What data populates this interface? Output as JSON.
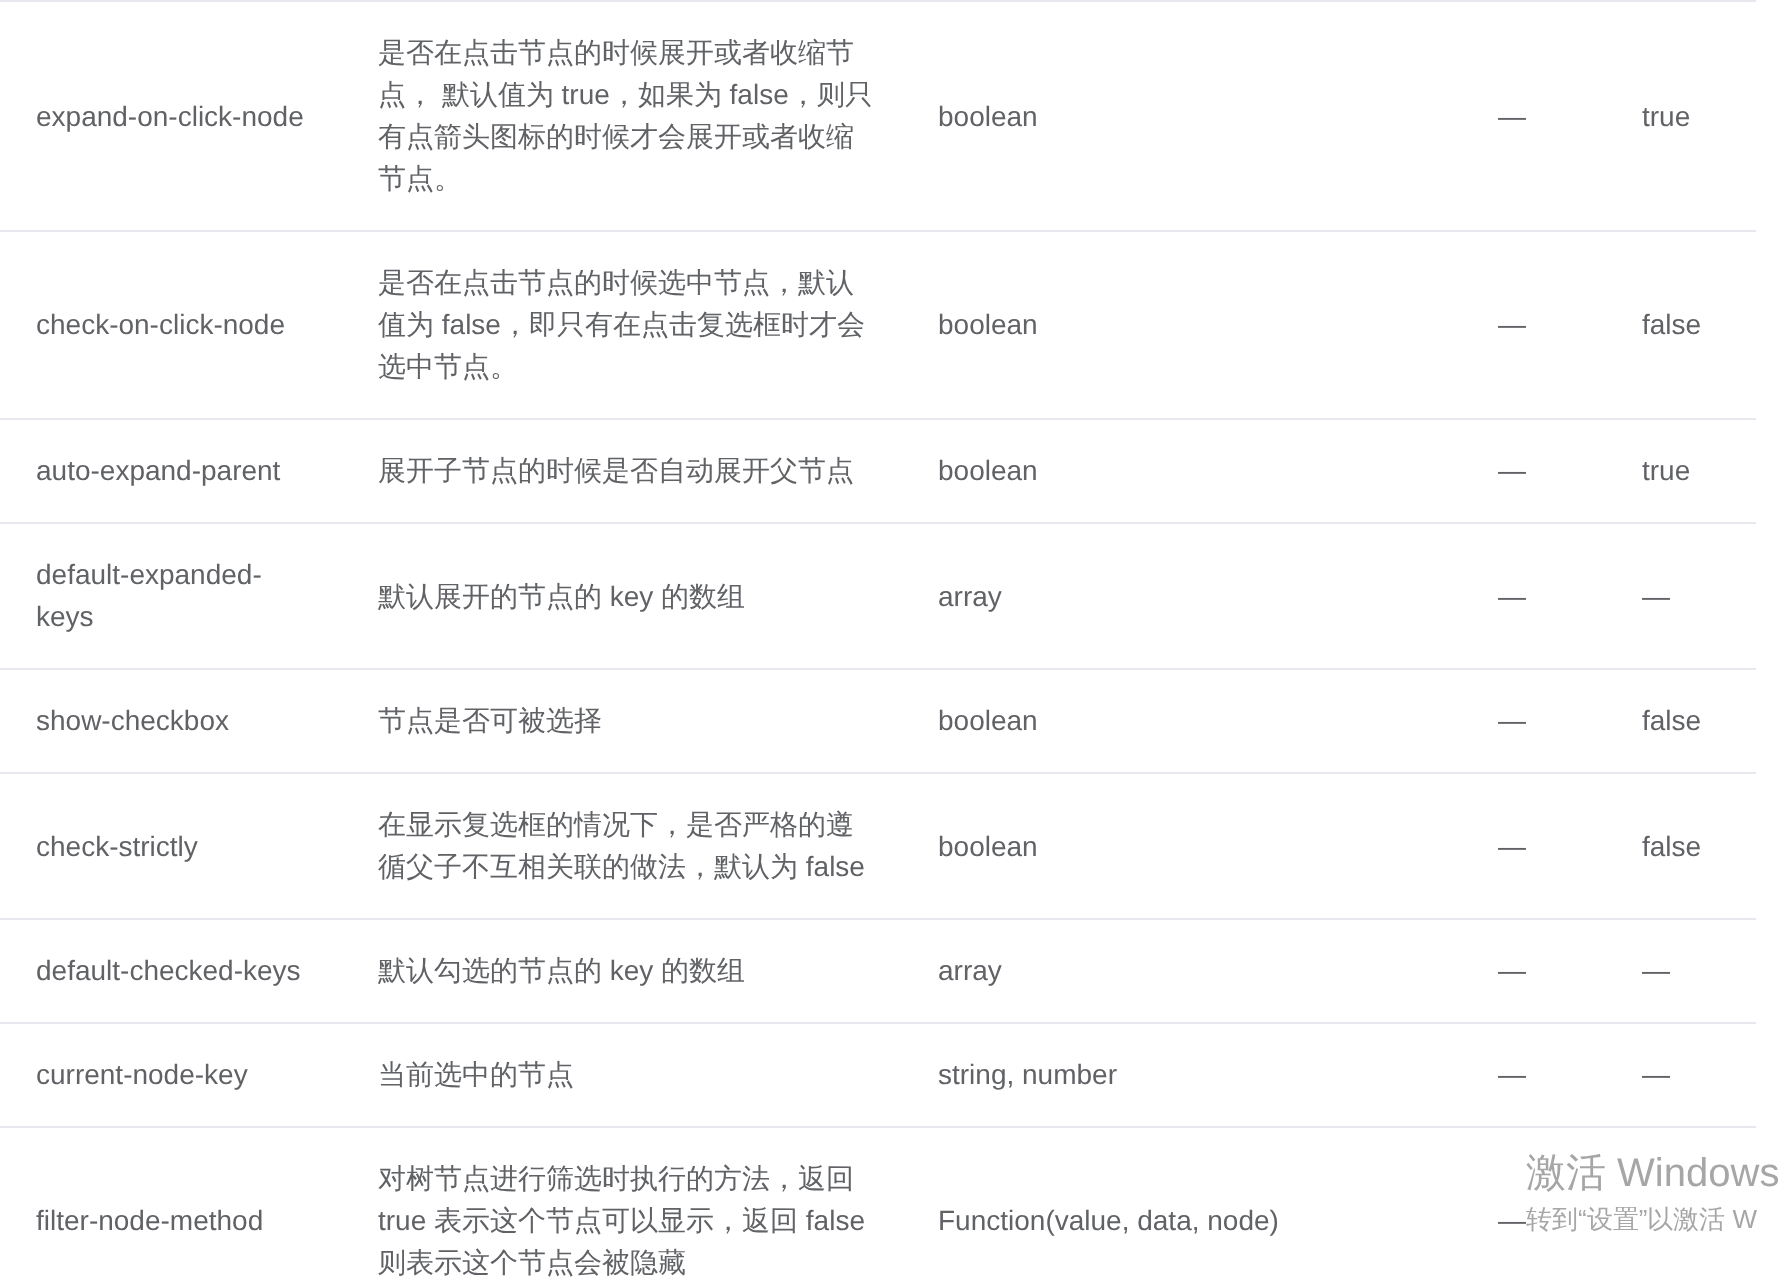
{
  "table": {
    "rows": [
      {
        "cells": [
          "expand-on-click-node",
          "是否在点击节点的时候展开或者收缩节点， 默认值为 true，如果为 false，则只有点箭头图标的时候才会展开或者收缩节点。",
          "boolean",
          "—",
          "true"
        ]
      },
      {
        "cells": [
          "check-on-click-node",
          "是否在点击节点的时候选中节点，默认值为 false，即只有在点击复选框时才会选中节点。",
          "boolean",
          "—",
          "false"
        ]
      },
      {
        "cells": [
          "auto-expand-parent",
          "展开子节点的时候是否自动展开父节点",
          "boolean",
          "—",
          "true"
        ]
      },
      {
        "cells": [
          "default-expanded-keys",
          "默认展开的节点的 key 的数组",
          "array",
          "—",
          "—"
        ]
      },
      {
        "cells": [
          "show-checkbox",
          "节点是否可被选择",
          "boolean",
          "—",
          "false"
        ]
      },
      {
        "cells": [
          "check-strictly",
          "在显示复选框的情况下，是否严格的遵循父子不互相关联的做法，默认为 false",
          "boolean",
          "—",
          "false"
        ]
      },
      {
        "cells": [
          "default-checked-keys",
          "默认勾选的节点的 key 的数组",
          "array",
          "—",
          "—"
        ]
      },
      {
        "cells": [
          "current-node-key",
          "当前选中的节点",
          "string, number",
          "—",
          "—"
        ]
      },
      {
        "cells": [
          "filter-node-method",
          "对树节点进行筛选时执行的方法，返回 true 表示这个节点可以显示，返回 false 则表示这个节点会被隐藏",
          "Function(value, data, node)",
          "—",
          ""
        ]
      }
    ]
  },
  "os_overlay": {
    "title": "激活 Windows",
    "subtitle": "转到“设置”以激活 W"
  }
}
